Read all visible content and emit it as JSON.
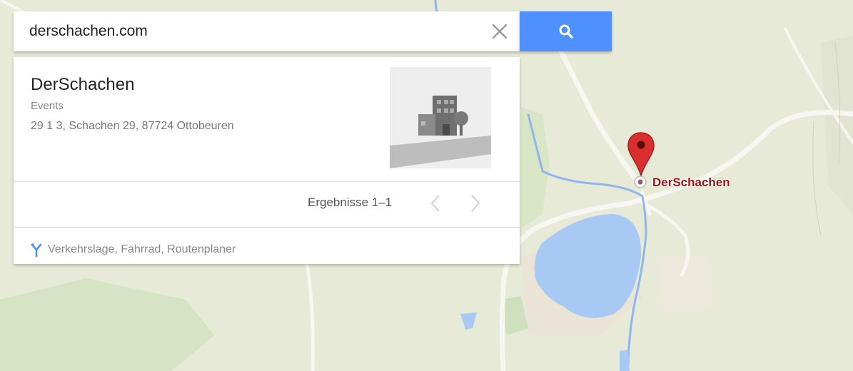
{
  "search": {
    "value": "derschachen.com",
    "clear_icon": "close-icon",
    "search_icon": "search-icon"
  },
  "result": {
    "name": "DerSchachen",
    "category": "Events",
    "address": "29 1 3, Schachen 29, 87724 Ottobeuren",
    "thumbnail_icon": "building-icon"
  },
  "pager": {
    "text": "Ergebnisse 1–1"
  },
  "extras": {
    "label": "Verkehrslage, Fahrrad, Routenplaner",
    "icon": "route-fork-icon"
  },
  "map": {
    "marker_label": "DerSchachen",
    "marker_color": "#d9302f",
    "label_color": "#a21313",
    "water_color": "#a2c4f3",
    "land_color": "#e8ecd9",
    "road_color": "#f6f4ee"
  },
  "colors": {
    "accent": "#4d90fe"
  }
}
